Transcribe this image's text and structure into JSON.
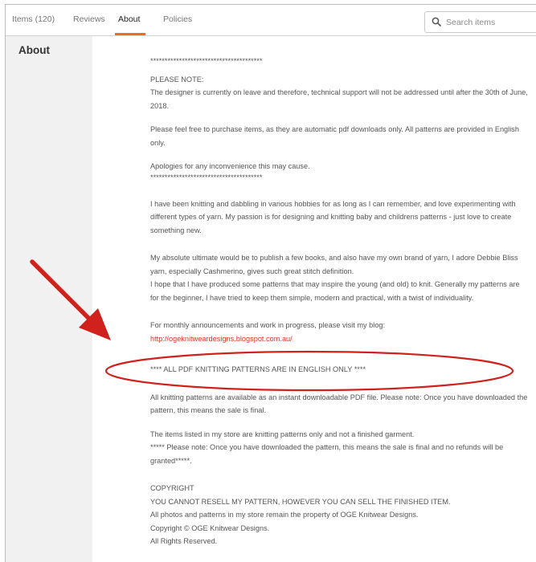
{
  "tabs": [
    {
      "label": "Items (120)"
    },
    {
      "label": "Reviews"
    },
    {
      "label": "About"
    },
    {
      "label": "Policies"
    }
  ],
  "active_tab": "About",
  "search": {
    "placeholder": "Search items"
  },
  "section_heading": "About",
  "colors": {
    "accent": "#f26b21",
    "annotation_red": "#d0211c",
    "link": "#d9361f",
    "sidebar_bg": "#f1f1f1"
  },
  "annotation_arrow_icon": "red-arrow",
  "about": {
    "stars_top": "***************************************",
    "note_title": "PLEASE NOTE:",
    "note_1": "The designer is currently on leave and therefore, technical support will not be addressed until after the 30th of June, 2018.",
    "note_2": "Please feel free to purchase items, as they are automatic pdf downloads only. All patterns are provided in English only.",
    "note_3": "Apologies for any inconvenience this may cause.",
    "stars_bottom": "***************************************",
    "para_1": "I have been knitting and dabbling in various hobbies for as long as I can remember, and love experimenting with different types of yarn. My passion is for designing and knitting baby and childrens patterns - just love to create something new.",
    "para_2a": "My absolute ultimate would be to publish a few books, and also have my own brand of yarn, I adore Debbie Bliss yarn, especially Cashmerino, gives such great stitch definition.",
    "para_2b": "I hope that I have produced some patterns that may inspire the young (and old) to knit. Generally my patterns are for the beginner, I have tried to keep them simple, modern and practical, with a twist of individuality.",
    "blog_intro": "For monthly announcements and work in progress, please visit my blog:",
    "blog_link": "http://ogeknitweardesigns.blogspot.com.au/",
    "english_only": "**** ALL PDF KNITTING PATTERNS ARE IN ENGLISH ONLY ****",
    "para_3": "All knitting patterns are available as an instant downloadable PDF file. Please note: Once you have downloaded the pattern, this means the sale is final.",
    "para_4a": "The items listed in my store are knitting patterns only and not a finished garment.",
    "para_4b": "***** Please note: Once you have downloaded the pattern, this means the sale is final and no refunds will be granted*****.",
    "copyright_title": "COPYRIGHT",
    "copyright_1": "YOU CANNOT RESELL MY PATTERN, HOWEVER YOU CAN SELL THE FINISHED ITEM.",
    "copyright_2": "All photos and patterns in my store remain the property of OGE Knitwear Designs.",
    "copyright_3": "Copyright © OGE Knitwear Designs.",
    "copyright_4": "All Rights Reserved."
  }
}
